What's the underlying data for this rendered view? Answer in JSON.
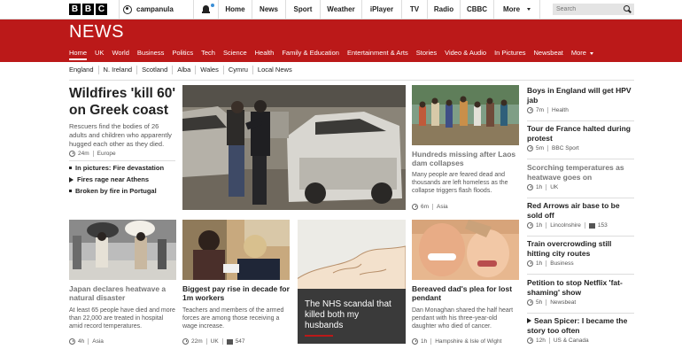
{
  "topbar": {
    "logo_letters": [
      "B",
      "B",
      "C"
    ],
    "username": "campanula",
    "nav": [
      "Home",
      "News",
      "Sport",
      "Weather",
      "iPlayer",
      "TV",
      "Radio",
      "CBBC",
      "More"
    ],
    "search_placeholder": "Search"
  },
  "masthead": "NEWS",
  "mainnav": [
    "Home",
    "UK",
    "World",
    "Business",
    "Politics",
    "Tech",
    "Science",
    "Health",
    "Family & Education",
    "Entertainment & Arts",
    "Stories",
    "Video & Audio",
    "In Pictures",
    "Newsbeat",
    "More"
  ],
  "subnav": [
    "England",
    "N. Ireland",
    "Scotland",
    "Alba",
    "Wales",
    "Cymru",
    "Local News"
  ],
  "lead": {
    "title": "Wildfires 'kill 60' on Greek coast",
    "summary": "Rescuers find the bodies of 26 adults and children who apparently hugged each other as they died.",
    "time": "24m",
    "section": "Europe",
    "related": [
      {
        "label": "In pictures: Fire devastation",
        "icon": "bullet"
      },
      {
        "label": "Fires rage near Athens",
        "icon": "play"
      },
      {
        "label": "Broken by fire in Portugal",
        "icon": "bullet"
      }
    ]
  },
  "laos": {
    "title": "Hundreds missing after Laos dam collapses",
    "summary": "Many people are feared dead and thousands are left homeless as the collapse triggers flash floods.",
    "time": "6m",
    "section": "Asia"
  },
  "japan": {
    "title": "Japan declares heatwave a natural disaster",
    "summary": "At least 65 people have died and more than 22,000 are treated in hospital amid record temperatures.",
    "time": "4h",
    "section": "Asia"
  },
  "payrise": {
    "title": "Biggest pay rise in decade for 1m workers",
    "summary": "Teachers and members of the armed forces are among those receiving a wage increase.",
    "time": "22m",
    "section": "UK",
    "comments": "547"
  },
  "nhs": {
    "title": "The NHS scandal that killed both my husbands"
  },
  "bereaved": {
    "title": "Bereaved dad's plea for lost pendant",
    "summary": "Dan Monaghan shared the half heart pendant with his three-year-old daughter who died of cancer.",
    "time": "1h",
    "section": "Hampshire & Isle of Wight"
  },
  "right_column": [
    {
      "title": "Boys in England will get HPV jab",
      "time": "7m",
      "section": "Health",
      "grey": false
    },
    {
      "title": "Tour de France halted during protest",
      "time": "5m",
      "section": "BBC Sport",
      "grey": false
    },
    {
      "title": "Scorching temperatures as heatwave goes on",
      "time": "1h",
      "section": "UK",
      "grey": true
    },
    {
      "title": "Red Arrows air base to be sold off",
      "time": "1h",
      "section": "Lincolnshire",
      "comments": "153",
      "grey": false
    },
    {
      "title": "Train overcrowding still hitting city routes",
      "time": "1h",
      "section": "Business",
      "grey": false
    },
    {
      "title": "Petition to stop Netflix 'fat-shaming' show",
      "time": "5h",
      "section": "Newsbeat",
      "grey": false
    },
    {
      "title": "Sean Spicer: I became the story too often",
      "time": "12h",
      "section": "US & Canada",
      "grey": false,
      "video": true
    }
  ],
  "colors": {
    "brand_red": "#bb1919",
    "accent_blue": "#3a8fd6"
  }
}
